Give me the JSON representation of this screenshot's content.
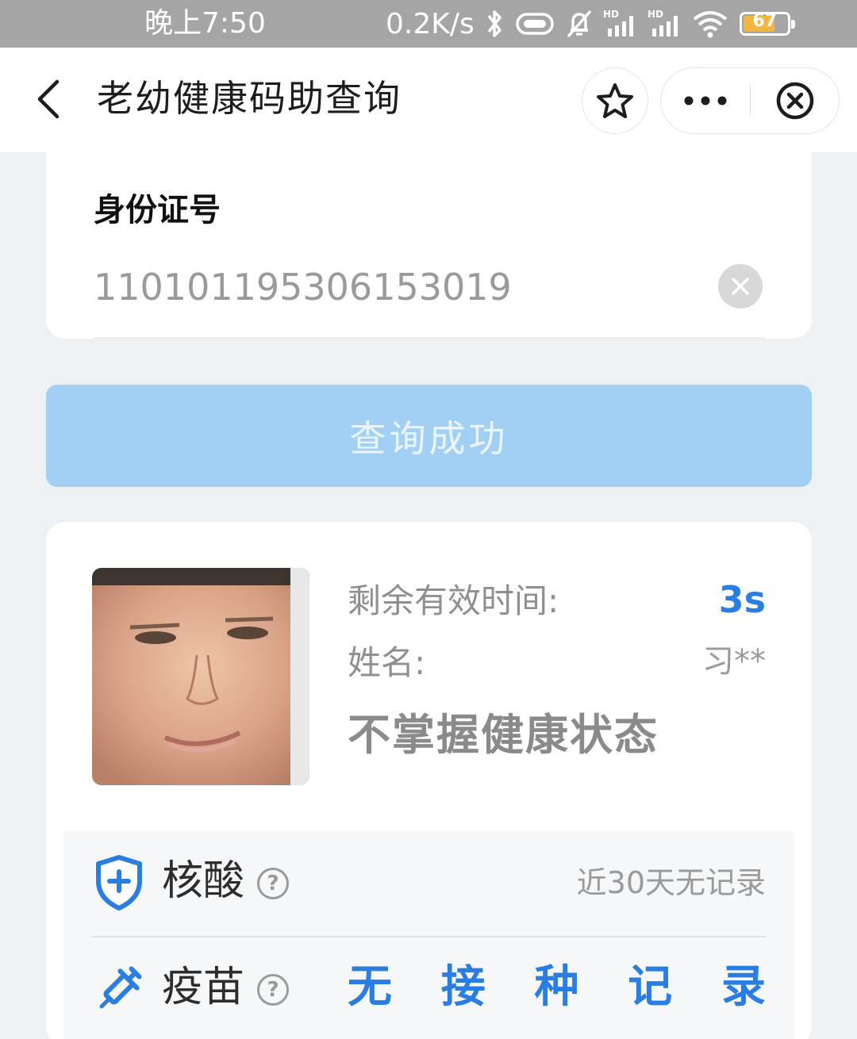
{
  "status_bar": {
    "time": "晚上7:50",
    "network_speed": "0.2K/s",
    "battery_level": "67",
    "icons": [
      "bluetooth-icon",
      "vibrate-icon",
      "mute-bell-icon",
      "signal-hd-icon",
      "signal-hd-icon",
      "wifi-icon",
      "battery-icon"
    ]
  },
  "nav": {
    "title": "老幼健康码助查询",
    "icons": [
      "back-arrow-icon",
      "star-icon",
      "more-dots-icon",
      "close-circle-icon"
    ]
  },
  "id_section": {
    "label": "身份证号",
    "value": "110101195306153019"
  },
  "query_button": {
    "label": "查询成功"
  },
  "result": {
    "remaining_label": "剩余有效时间:",
    "remaining_value": "3s",
    "name_label": "姓名:",
    "name_value": "习**",
    "health_status": "不掌握健康状态",
    "nucleic": {
      "title": "核酸",
      "status": "近30天无记录",
      "icon": "shield-plus-icon"
    },
    "vaccine": {
      "title": "疫苗",
      "status_chars": [
        "无",
        "接",
        "种",
        "记",
        "录"
      ],
      "icon": "syringe-icon"
    }
  },
  "colors": {
    "accent_blue": "#2a7de1",
    "button_disabled": "#a2d0f5",
    "background": "#eef1f4",
    "status_bar": "#a5a5a5"
  }
}
